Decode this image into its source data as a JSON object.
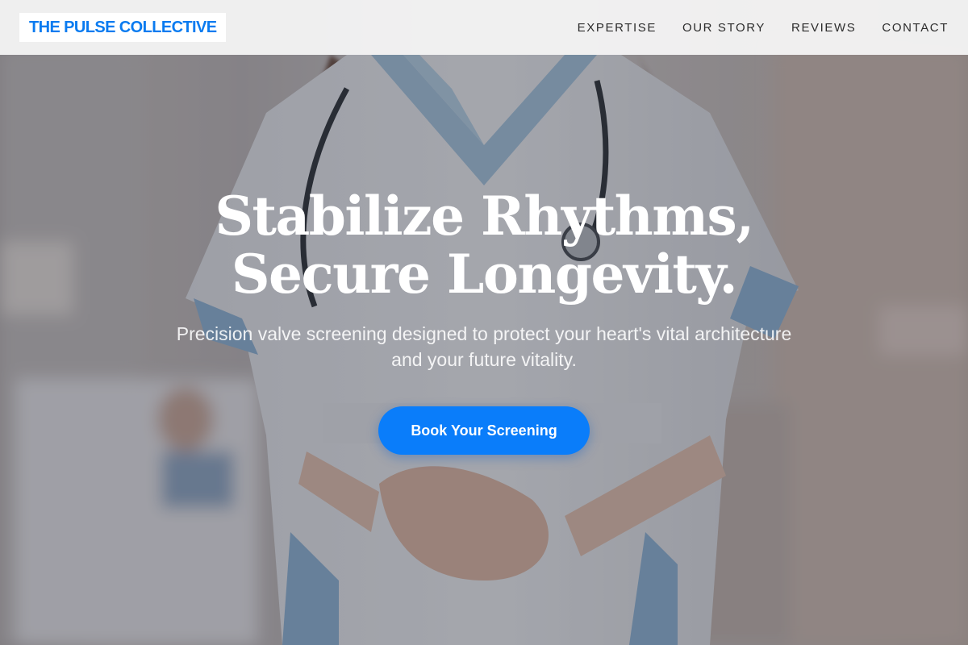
{
  "brand": {
    "name": "THE PULSE COLLECTIVE"
  },
  "nav": {
    "items": [
      {
        "label": "EXPERTISE"
      },
      {
        "label": "OUR STORY"
      },
      {
        "label": "REVIEWS"
      },
      {
        "label": "CONTACT"
      }
    ]
  },
  "hero": {
    "headline_line1": "Stabilize Rhythms,",
    "headline_line2": "Secure Longevity.",
    "subheading_line1": "Precision valve screening designed to protect your heart's vital architecture",
    "subheading_line2": "and your future vitality.",
    "cta_label": "Book Your Screening"
  },
  "colors": {
    "accent": "#0a7dfa",
    "logo_text": "#0a7bf0",
    "nav_background": "#f4f4f4"
  }
}
